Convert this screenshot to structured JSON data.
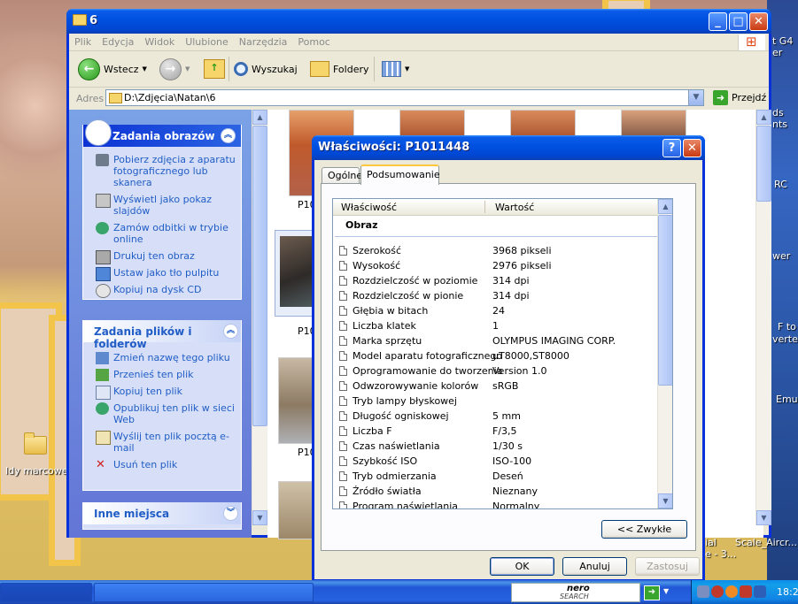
{
  "desktop": {
    "right_labels": [
      "t G4",
      "er",
      "ds",
      "nts",
      "RC",
      "wer",
      "F to",
      "verter",
      "Emu",
      "ial",
      "e - 3...",
      "Scale_Aircr..."
    ],
    "folder_label": "Idy marcowe"
  },
  "explorer": {
    "title": "6",
    "menu": [
      "Plik",
      "Edycja",
      "Widok",
      "Ulubione",
      "Narzędzia",
      "Pomoc"
    ],
    "toolbar": {
      "back": "Wstecz",
      "search": "Wyszukaj",
      "folders": "Foldery"
    },
    "address": {
      "label": "Adres",
      "value": "D:\\Zdjęcia\\Natan\\6",
      "go": "Przejdź"
    },
    "task_pane": {
      "picture_tasks": {
        "title": "Zadania obrazów",
        "items": [
          "Pobierz zdjęcia z aparatu fotograficznego lub skanera",
          "Wyświetl jako pokaz slajdów",
          "Zamów odbitki w trybie online",
          "Drukuj ten obraz",
          "Ustaw jako tło pulpitu",
          "Kopiuj na dysk CD"
        ]
      },
      "file_tasks": {
        "title": "Zadania plików i folderów",
        "items": [
          "Zmień nazwę tego pliku",
          "Przenieś ten plik",
          "Kopiuj ten plik",
          "Opublikuj ten plik w sieci Web",
          "Wyślij ten plik pocztą e-mail",
          "Usuń ten plik"
        ]
      },
      "other_places": {
        "title": "Inne miejsca"
      }
    },
    "thumb_labels": [
      "P10",
      "P10",
      "P10"
    ]
  },
  "dialog": {
    "title": "Właściwości: P1011448",
    "tabs": [
      "Ogólne",
      "Podsumowanie"
    ],
    "active_tab": 1,
    "columns": [
      "Właściwość",
      "Wartość"
    ],
    "group": "Obraz",
    "rows": [
      {
        "name": "Szerokość",
        "value": "3968 pikseli"
      },
      {
        "name": "Wysokość",
        "value": "2976 pikseli"
      },
      {
        "name": "Rozdzielczość w poziomie",
        "value": "314 dpi"
      },
      {
        "name": "Rozdzielczość w pionie",
        "value": "314 dpi"
      },
      {
        "name": "Głębia w bitach",
        "value": "24"
      },
      {
        "name": "Liczba klatek",
        "value": "1"
      },
      {
        "name": "Marka sprzętu",
        "value": "OLYMPUS IMAGING CORP."
      },
      {
        "name": "Model aparatu fotograficznego",
        "value": "uT8000,ST8000"
      },
      {
        "name": "Oprogramowanie do tworzenia",
        "value": "Version 1.0"
      },
      {
        "name": "Odwzorowywanie kolorów",
        "value": "sRGB"
      },
      {
        "name": "Tryb lampy błyskowej",
        "value": ""
      },
      {
        "name": "Długość ogniskowej",
        "value": "5 mm"
      },
      {
        "name": "Liczba F",
        "value": "F/3,5"
      },
      {
        "name": "Czas naświetlania",
        "value": "1/30 s"
      },
      {
        "name": "Szybkość ISO",
        "value": "ISO-100"
      },
      {
        "name": "Tryb odmierzania",
        "value": "Deseń"
      },
      {
        "name": "Źródło światła",
        "value": "Nieznany"
      },
      {
        "name": "Program naświetlania",
        "value": "Normalny"
      }
    ],
    "simple_button": "<< Zwykłe",
    "buttons": {
      "ok": "OK",
      "cancel": "Anuluj",
      "apply": "Zastosuj"
    }
  },
  "taskbar": {
    "nero": {
      "line1": "nero",
      "line2": "SEARCH"
    },
    "clock": "18:2"
  },
  "colors": {
    "xp_blue": "#0831d9",
    "task_link": "#215dc6",
    "tab_highlight": "#ffc83c"
  }
}
